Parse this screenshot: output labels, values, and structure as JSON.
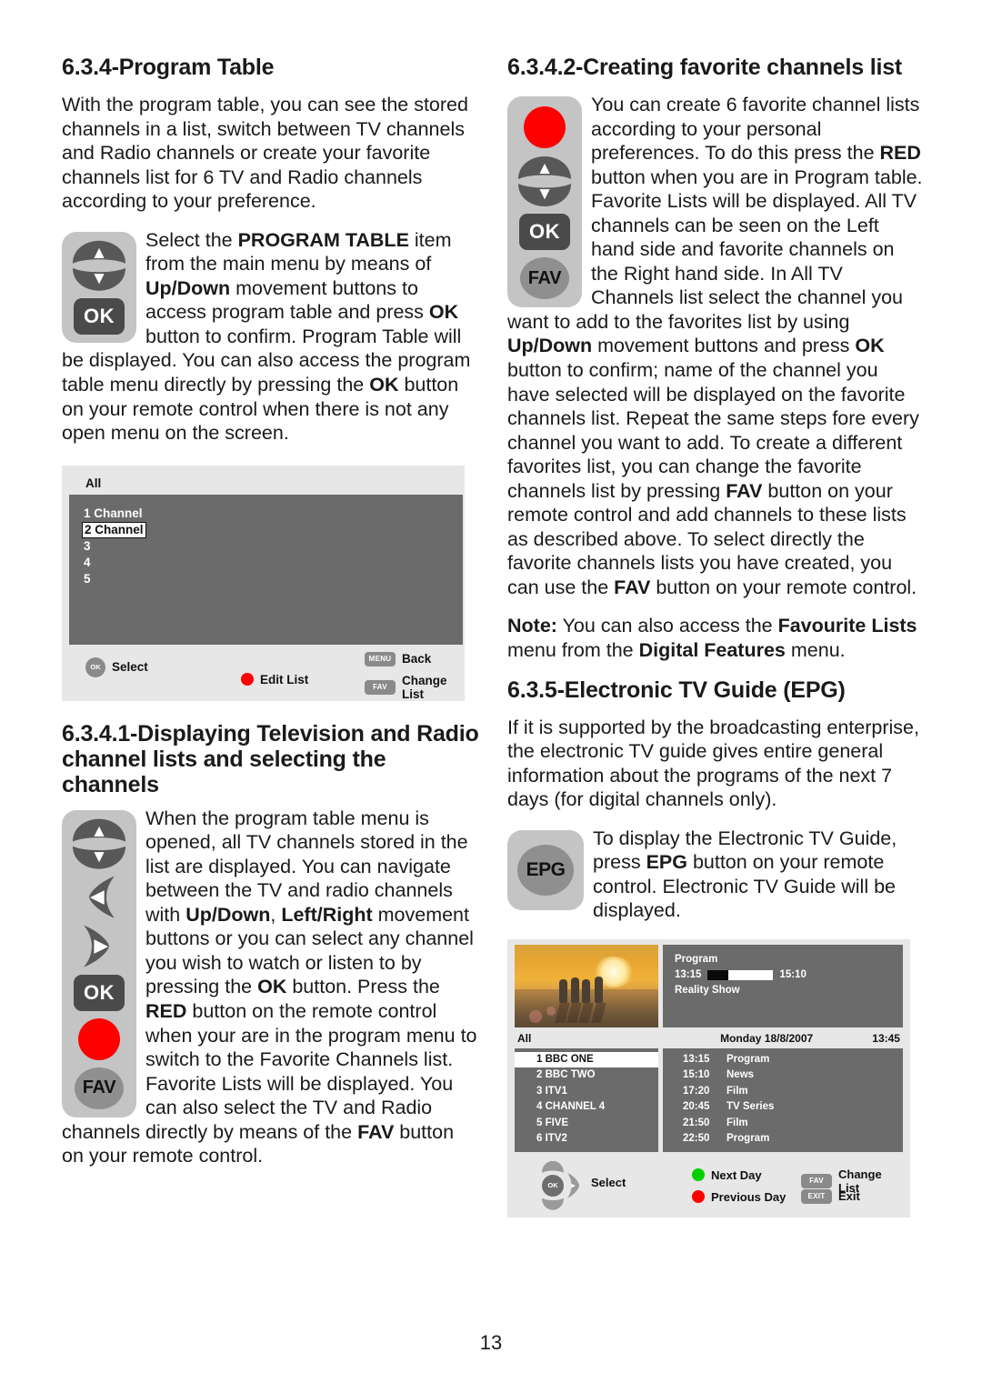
{
  "page": {
    "number": "13"
  },
  "left_column": {
    "section1": {
      "heading": "6.3.4-Program Table",
      "intro": "With the program table, you can see the stored channels in a list, switch between TV channels and Radio channels or create your favorite channels list for 6 TV and Radio channels according to your preference.",
      "body_parts": {
        "p1": "Select the ",
        "b1": "PROGRAM TABLE",
        "p2": " item from the main menu by means of ",
        "b2": "Up/Down",
        "p3": " movement buttons to access program table and press ",
        "b3": "OK",
        "p4": " button to confirm. Program Table will be displayed. You can also access the program table menu directly by pressing the ",
        "b4": "OK",
        "p5": " button on your remote control when there is not any open menu on the screen."
      },
      "remote_buttons": [
        "up",
        "down",
        "OK"
      ]
    },
    "program_table_osd": {
      "title": "All",
      "rows": [
        {
          "label": "1 Channel",
          "selected": false
        },
        {
          "label": "2 Channel",
          "selected": true
        },
        {
          "label": "3",
          "selected": false
        },
        {
          "label": "4",
          "selected": false
        },
        {
          "label": "5",
          "selected": false
        }
      ],
      "hints": {
        "select": {
          "key": "OK",
          "label": "Select"
        },
        "edit_list": {
          "key": "red-dot",
          "label": "Edit List"
        },
        "back": {
          "key": "MENU",
          "label": "Back"
        },
        "change_list": {
          "key": "FAV",
          "label": "Change List"
        }
      }
    },
    "section2": {
      "heading": "6.3.4.1-Displaying Television and Radio channel lists and selecting the channels",
      "body_parts": {
        "p1": "When the program table menu is opened, all TV channels stored in the list are displayed. You can navigate between the TV and radio channels with ",
        "b1": "Up/Down",
        "p2": ", ",
        "b2": "Left/Right",
        "p3": " movement buttons or you can select any channel you wish to watch or listen to by pressing the ",
        "b3": "OK",
        "p4": " button. Press the ",
        "b4": "RED",
        "p5": " button on the remote control when your are in the program menu to switch to the Favorite Channels list. Favorite Lists will be displayed. You can also select the TV and Radio channels directly by means of the ",
        "b5": "FAV",
        "p6": " button on your remote control."
      },
      "remote_buttons": [
        "up",
        "down",
        "left",
        "right",
        "OK",
        "red",
        "FAV"
      ]
    }
  },
  "right_column": {
    "section3": {
      "heading": "6.3.4.2-Creating favorite channels list",
      "body_parts": {
        "p1": "You can create 6 favorite channel lists according to your personal preferences. To do this press the ",
        "b1": "RED",
        "p2": " button when you are in Program table. Favorite Lists will be displayed. All TV channels can be seen on the Left hand side and favorite channels on the Right hand side. In All TV Channels list select the channel you want to add to the favorites list by using ",
        "b2": "Up/Down",
        "p3": " movement buttons and press ",
        "b3": "OK",
        "p4": " button to confirm; name of the channel you have selected will be displayed on the favorite channels list. Repeat the same steps fore every channel you want to add. To create a different favorites list, you can change the favorite channels list by pressing ",
        "b4": "FAV",
        "p5": " button on your remote control and add channels to these lists as described above. To select directly the favorite channels lists you have created, you can use the ",
        "b5": "FAV",
        "p6": " button on your remote control."
      },
      "remote_buttons": [
        "red",
        "up",
        "down",
        "OK",
        "FAV"
      ],
      "note": {
        "b1": "Note:",
        "p1": " You can also access the ",
        "b2": "Favourite Lists",
        "p2": " menu from the ",
        "b3": "Digital Features",
        "p3": " menu."
      }
    },
    "section4": {
      "heading": "6.3.5-Electronic TV Guide (EPG)",
      "intro": "If it is supported  by the broadcasting enterprise, the electronic TV guide gives entire general information about the programs of the next 7 days (for digital channels only).",
      "body_parts": {
        "p1": "To display the Electronic TV Guide, press ",
        "b1": "EPG",
        "p2": " button on your remote control. Electronic TV Guide will be displayed."
      },
      "remote_button": "EPG"
    },
    "epg_osd": {
      "preview": {
        "program_label": "Program",
        "start_time": "13:15",
        "end_time": "15:10",
        "genre": "Reality Show",
        "progress_percent": 32
      },
      "all_label": "All",
      "date": "Monday 18/8/2007",
      "clock": "13:45",
      "channels": [
        {
          "label": "1 BBC ONE",
          "selected": true
        },
        {
          "label": "2 BBC TWO",
          "selected": false
        },
        {
          "label": "3 ITV1",
          "selected": false
        },
        {
          "label": "4 CHANNEL 4",
          "selected": false
        },
        {
          "label": "5 FIVE",
          "selected": false
        },
        {
          "label": "6 ITV2",
          "selected": false
        }
      ],
      "programs": [
        {
          "time": "13:15",
          "title": "Program"
        },
        {
          "time": "15:10",
          "title": "News"
        },
        {
          "time": "17:20",
          "title": "Film"
        },
        {
          "time": "20:45",
          "title": "TV Series"
        },
        {
          "time": "21:50",
          "title": "Film"
        },
        {
          "time": "22:50",
          "title": "Program"
        }
      ],
      "hints": {
        "select": {
          "key": "OK",
          "label": "Select"
        },
        "next_day": {
          "key": "green-dot",
          "label": "Next Day"
        },
        "previous_day": {
          "key": "red-dot",
          "label": "Previous Day"
        },
        "change_list": {
          "key": "FAV",
          "label": "Change List"
        },
        "exit": {
          "key": "EXIT",
          "label": "Exit"
        }
      }
    }
  },
  "colors": {
    "red_button": "#fe0000",
    "green_button": "#00d000",
    "osd_background": "#6b6b6b",
    "panel_background": "#e7e7e7"
  }
}
